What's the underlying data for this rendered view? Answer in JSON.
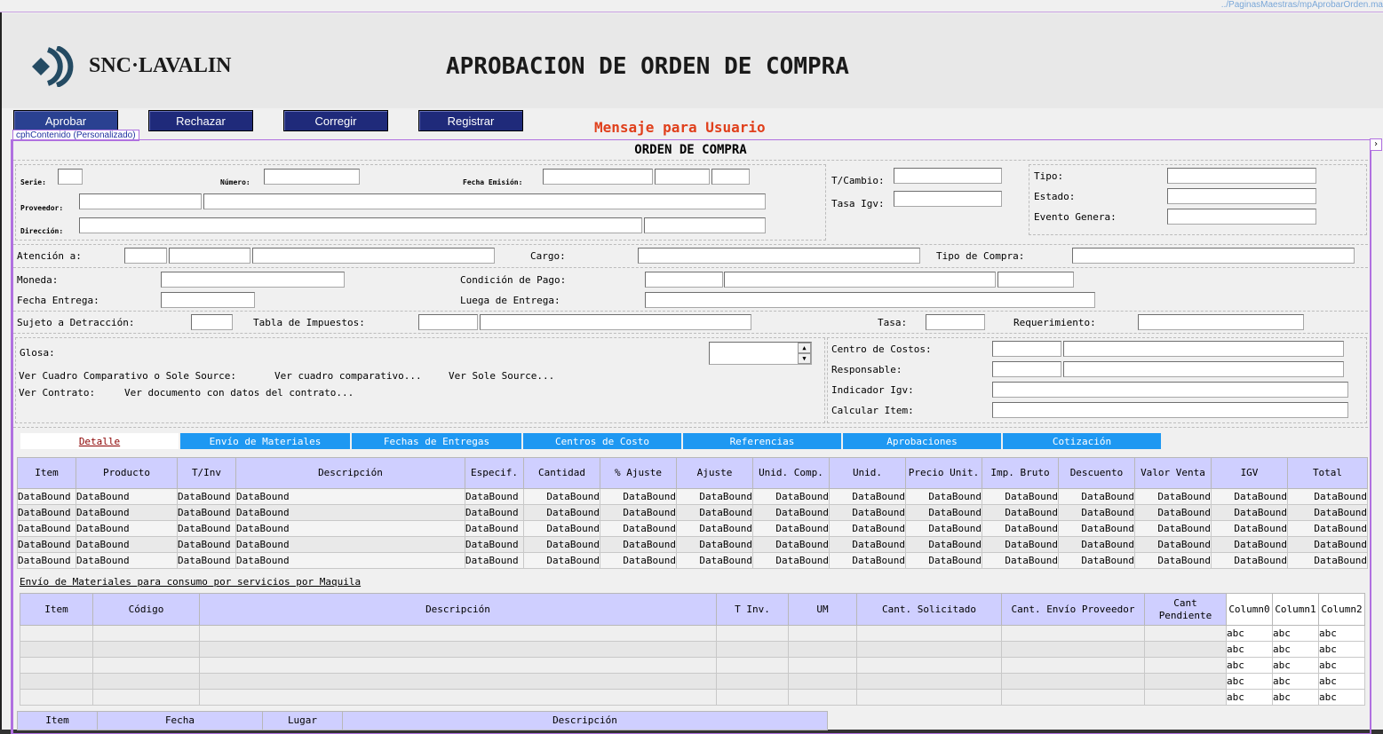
{
  "top_bar": {
    "path_text": "../PaginasMaestras/mpAprobarOrden.ma"
  },
  "header": {
    "logo_text": "SNC·LAVALIN",
    "title": "APROBACION DE ORDEN DE COMPRA"
  },
  "toolbar": {
    "buttons": [
      {
        "label": "Aprobar"
      },
      {
        "label": "Rechazar"
      },
      {
        "label": "Corregir"
      },
      {
        "label": "Registrar"
      }
    ],
    "message": "Mensaje para Usuario",
    "content_placeholder_label": "cphContenido (Personalizado)"
  },
  "colors": {
    "button_bg": "#1f2a7a",
    "tab_bg": "#1e98f2",
    "header_bg": "#cfcfff",
    "message": "#e0401c",
    "frame": "#b070e0"
  },
  "form": {
    "section_title": "ORDEN DE COMPRA",
    "serie_label": "Serie:",
    "numero_label": "Número:",
    "fecha_emision_label": "Fecha Emisión:",
    "proveedor_label": "Proveedor:",
    "direccion_label": "Dirección:",
    "tcambio_label": "T/Cambio:",
    "tasa_igv_label": "Tasa Igv:",
    "tipo_label": "Tipo:",
    "estado_label": "Estado:",
    "evento_genera_label": "Evento Genera:",
    "atencion_label": "Atención a:",
    "cargo_label": "Cargo:",
    "tipo_compra_label": "Tipo de Compra:",
    "moneda_label": "Moneda:",
    "condicion_pago_label": "Condición de Pago:",
    "fecha_entrega_label": "Fecha Entrega:",
    "lugar_entrega_label": "Luega de Entrega:",
    "sujeto_detraccion_label": "Sujeto a Detracción:",
    "tabla_impuestos_label": "Tabla de Impuestos:",
    "tasa_label": "Tasa:",
    "requerimiento_label": "Requerimiento:",
    "glosa_label": "Glosa:",
    "ver_cuadro_label": "Ver Cuadro Comparativo o Sole Source:",
    "ver_cuadro_link": "Ver cuadro comparativo...",
    "ver_sole_link": "Ver Sole Source...",
    "ver_contrato_label": "Ver Contrato:",
    "ver_contrato_link": "Ver documento con datos del contrato...",
    "centro_costos_label": "Centro de Costos:",
    "responsable_label": "Responsable:",
    "indicador_igv_label": "Indicador Igv:",
    "calcular_item_label": "Calcular Item:"
  },
  "tabs": [
    {
      "label": "Detalle"
    },
    {
      "label": "Envío de Materiales"
    },
    {
      "label": "Fechas de Entregas"
    },
    {
      "label": "Centros de Costo"
    },
    {
      "label": "Referencias"
    },
    {
      "label": "Aprobaciones"
    },
    {
      "label": "Cotización"
    }
  ],
  "detail_grid": {
    "headers": [
      "Item",
      "Producto",
      "T/Inv",
      "Descripción",
      "Especif.",
      "Cantidad",
      "% Ajuste",
      "Ajuste",
      "Unid. Comp.",
      "Unid.",
      "Precio Unit.",
      "Imp. Bruto",
      "Descuento",
      "Valor Venta",
      "IGV",
      "Total"
    ],
    "rows": [
      [
        "DataBound",
        "DataBound",
        "DataBound",
        "DataBound",
        "DataBound",
        "DataBound",
        "DataBound",
        "DataBound",
        "DataBound",
        "DataBound",
        "DataBound",
        "DataBound",
        "DataBound",
        "DataBound",
        "DataBound",
        "DataBound"
      ],
      [
        "DataBound",
        "DataBound",
        "DataBound",
        "DataBound",
        "DataBound",
        "DataBound",
        "DataBound",
        "DataBound",
        "DataBound",
        "DataBound",
        "DataBound",
        "DataBound",
        "DataBound",
        "DataBound",
        "DataBound",
        "DataBound"
      ],
      [
        "DataBound",
        "DataBound",
        "DataBound",
        "DataBound",
        "DataBound",
        "DataBound",
        "DataBound",
        "DataBound",
        "DataBound",
        "DataBound",
        "DataBound",
        "DataBound",
        "DataBound",
        "DataBound",
        "DataBound",
        "DataBound"
      ],
      [
        "DataBound",
        "DataBound",
        "DataBound",
        "DataBound",
        "DataBound",
        "DataBound",
        "DataBound",
        "DataBound",
        "DataBound",
        "DataBound",
        "DataBound",
        "DataBound",
        "DataBound",
        "DataBound",
        "DataBound",
        "DataBound"
      ],
      [
        "DataBound",
        "DataBound",
        "DataBound",
        "DataBound",
        "DataBound",
        "DataBound",
        "DataBound",
        "DataBound",
        "DataBound",
        "DataBound",
        "DataBound",
        "DataBound",
        "DataBound",
        "DataBound",
        "DataBound",
        "DataBound"
      ]
    ]
  },
  "materials": {
    "title": "Envío de Materiales para consumo por servicios por Maquila",
    "headers": [
      "Item",
      "Código",
      "Descripción",
      "T Inv.",
      "UM",
      "Cant. Solicitado",
      "Cant. Envío Proveedor",
      "Cant Pendiente",
      "Column0",
      "Column1",
      "Column2"
    ],
    "rows": [
      [
        "",
        "",
        "",
        "",
        "",
        "",
        "",
        "",
        "abc",
        "abc",
        "abc"
      ],
      [
        "",
        "",
        "",
        "",
        "",
        "",
        "",
        "",
        "abc",
        "abc",
        "abc"
      ],
      [
        "",
        "",
        "",
        "",
        "",
        "",
        "",
        "",
        "abc",
        "abc",
        "abc"
      ],
      [
        "",
        "",
        "",
        "",
        "",
        "",
        "",
        "",
        "abc",
        "abc",
        "abc"
      ],
      [
        "",
        "",
        "",
        "",
        "",
        "",
        "",
        "",
        "abc",
        "abc",
        "abc"
      ]
    ]
  },
  "dates_grid": {
    "headers": [
      "Item",
      "Fecha",
      "Lugar",
      "Descripción"
    ]
  }
}
